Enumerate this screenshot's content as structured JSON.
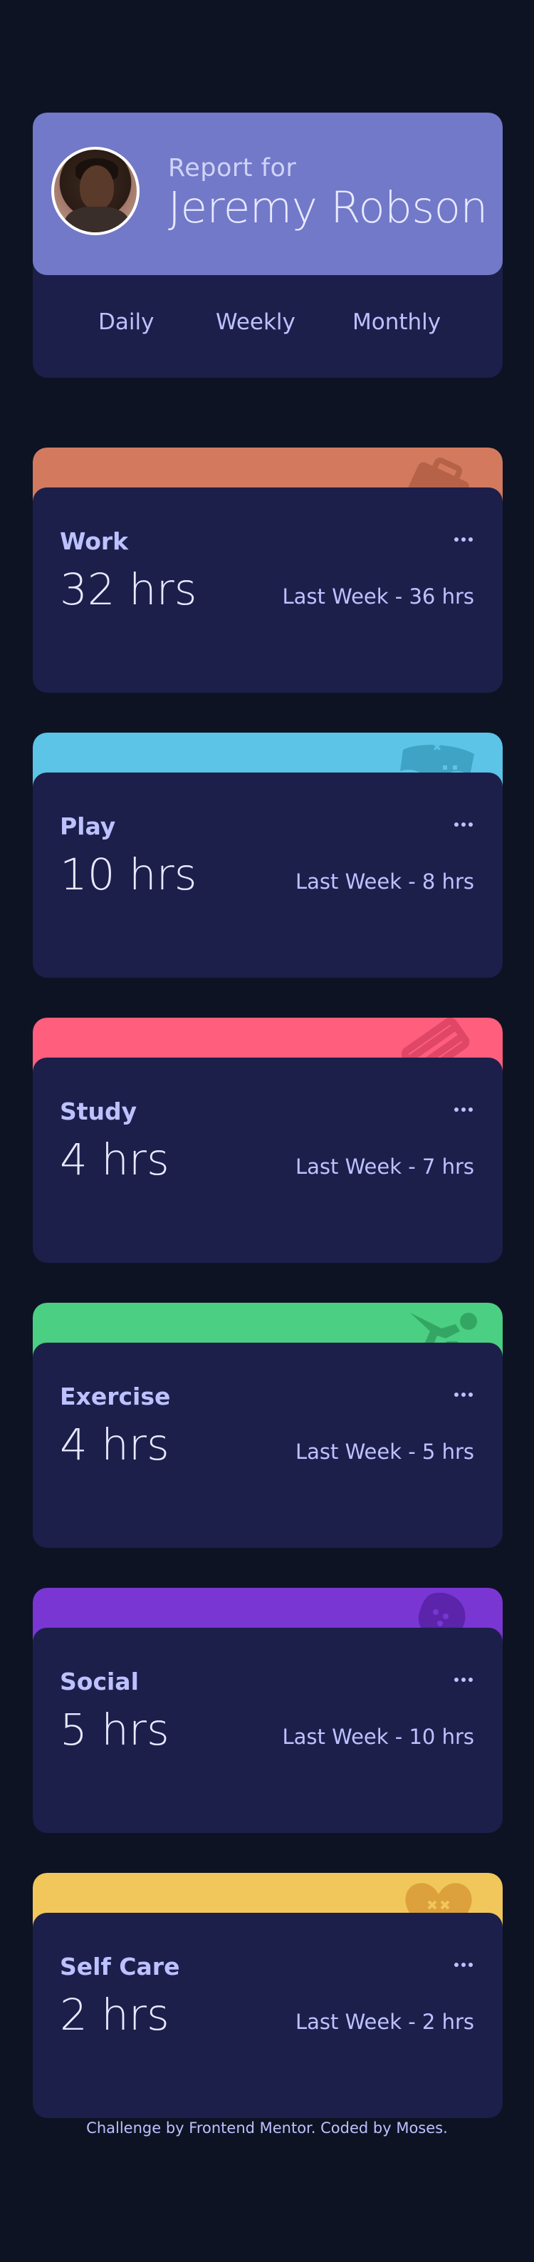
{
  "profile": {
    "report_for": "Report for",
    "name": "Jeremy Robson",
    "timeframes": [
      "Daily",
      "Weekly",
      "Monthly"
    ]
  },
  "cards": [
    {
      "title": "Work",
      "hours": "32 hrs",
      "last": "Last Week - 36 hrs",
      "color": "#ff8b64",
      "icon": "briefcase-icon"
    },
    {
      "title": "Play",
      "hours": "10 hrs",
      "last": "Last Week - 8 hrs",
      "color": "#55c2e6",
      "icon": "gamepad-icon"
    },
    {
      "title": "Study",
      "hours": "4 hrs",
      "last": "Last Week - 7 hrs",
      "color": "#ff5e7d",
      "icon": "book-icon"
    },
    {
      "title": "Exercise",
      "hours": "4 hrs",
      "last": "Last Week - 5 hrs",
      "color": "#4bcf82",
      "icon": "runner-icon"
    },
    {
      "title": "Social",
      "hours": "5 hrs",
      "last": "Last Week - 10 hrs",
      "color": "#7335d2",
      "icon": "chat-icon"
    },
    {
      "title": "Self Care",
      "hours": "2 hrs",
      "last": "Last Week - 2 hrs",
      "color": "#f1c75b",
      "icon": "heart-icon"
    }
  ],
  "footer": {
    "prefix": "Challenge by ",
    "link1": "Frontend Mentor",
    "mid": ". Coded by ",
    "link2": "Moses",
    "suffix": "."
  }
}
